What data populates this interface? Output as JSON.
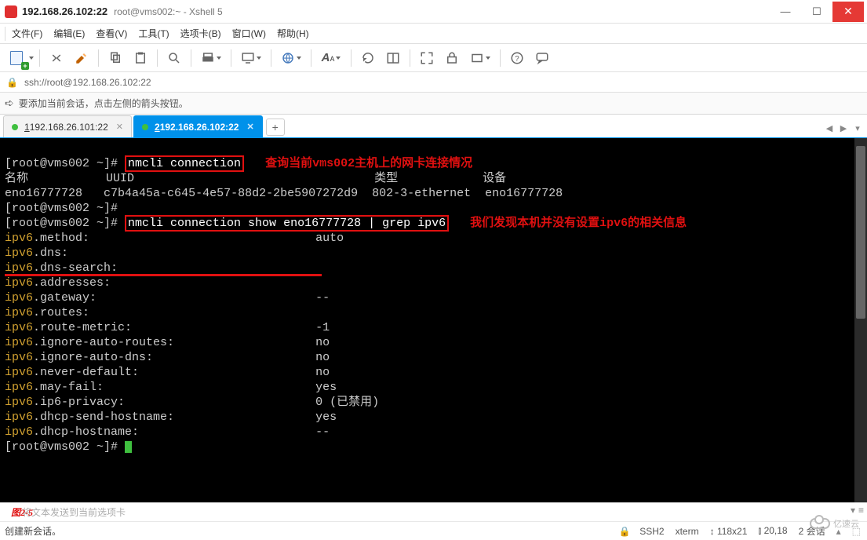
{
  "titlebar": {
    "host": "192.168.26.102:22",
    "subtitle": "root@vms002:~ - Xshell 5"
  },
  "menu": {
    "file": "文件(F)",
    "edit": "编辑(E)",
    "view": "查看(V)",
    "tools": "工具(T)",
    "tab": "选项卡(B)",
    "window": "窗口(W)",
    "help": "帮助(H)"
  },
  "address": {
    "url": "ssh://root@192.168.26.102:22"
  },
  "hint": {
    "text": "要添加当前会话，点击左侧的箭头按钮。"
  },
  "tabs": {
    "tab1_num": "1",
    "tab1_label": " 192.168.26.101:22",
    "tab2_num": "2",
    "tab2_label": " 192.168.26.102:22"
  },
  "terminal": {
    "prompt": "[root@vms002 ~]# ",
    "cmd1": "nmcli connection",
    "anno1": "查询当前vms002主机上的网卡连接情况",
    "header_name": "名称",
    "header_uuid": "UUID",
    "header_type": "类型",
    "header_device": "设备",
    "row_name": "eno16777728",
    "row_uuid": "c7b4a45a-c645-4e57-88d2-2be5907272d9",
    "row_type": "802-3-ethernet",
    "row_device": "eno16777728",
    "cmd2": "nmcli connection show eno16777728 | grep ipv6",
    "anno2": "我们发现本机并没有设置ipv6的相关信息",
    "method_k": "ipv6",
    "method_rest": ".method:",
    "method_v": "auto",
    "dns_rest": ".dns:",
    "dns_search_rest": ".dns-search:",
    "addresses_rest": ".addresses:",
    "gateway_rest": ".gateway:",
    "gateway_v": "--",
    "routes_rest": ".routes:",
    "route_metric_rest": ".route-metric:",
    "route_metric_v": "-1",
    "iar_rest": ".ignore-auto-routes:",
    "iar_v": "no",
    "iad_rest": ".ignore-auto-dns:",
    "iad_v": "no",
    "nd_rest": ".never-default:",
    "nd_v": "no",
    "mf_rest": ".may-fail:",
    "mf_v": "yes",
    "ip6p_rest": ".ip6-privacy:",
    "ip6p_v": "0 (已禁用)",
    "dsh_rest": ".dhcp-send-hostname:",
    "dsh_v": "yes",
    "dh_rest": ".dhcp-hostname:",
    "dh_v": "--"
  },
  "input": {
    "placeholder": "将文本发送到当前选项卡",
    "figure_label": "图2-5"
  },
  "status": {
    "left": "创建新会话。",
    "protocol": "SSH2",
    "term": "xterm",
    "size": "118x21",
    "pos": "20,18",
    "session": "2 会话",
    "watermark": "亿速云"
  }
}
